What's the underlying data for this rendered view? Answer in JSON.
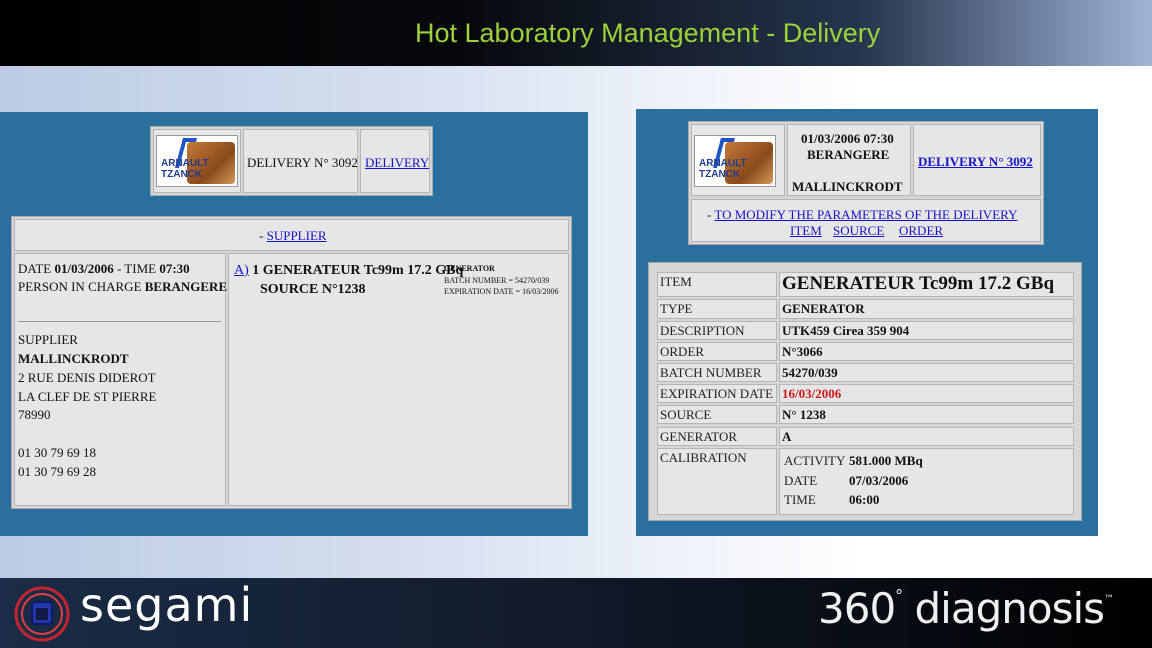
{
  "header": {
    "title": "Hot Laboratory Management - Delivery"
  },
  "footer": {
    "brand_left": "segami",
    "brand_right_number": "360",
    "brand_right_degree": "°",
    "brand_right_word": " diagnosis",
    "brand_right_tm": "™"
  },
  "logo": {
    "line1": "ARNAULT",
    "line2": "TZANCK"
  },
  "left": {
    "top_box": {
      "delivery_no": "DELIVERY N° 3092",
      "delivery_link": "DELIVERY"
    },
    "supplier_bar": {
      "prefix": "- ",
      "link": "SUPPLIER"
    },
    "info": {
      "date_prefix": "DATE ",
      "date": "01/03/2006",
      "time_prefix": " - TIME ",
      "time": "07:30",
      "person_prefix": "PERSON IN CHARGE ",
      "person": "BERANGERE",
      "supplier_label": "SUPPLIER",
      "supplier_name": "MALLINCKRODT",
      "address1": "2 RUE DENIS DIDEROT",
      "address2": "LA CLEF DE ST PIERRE",
      "zip": "78990",
      "phone1": "01 30 79 69 18",
      "phone2": "01 30 79 69 28"
    },
    "item": {
      "link": "A)",
      "line1": " 1 GENERATEUR Tc99m 17.2 GBq",
      "line2": "SOURCE N°1238",
      "tag": "GENERATOR",
      "batch": "BATCH NUMBER = 54270/039",
      "expiry": "EXPIRATION DATE = 16/03/2006"
    }
  },
  "right": {
    "top_box": {
      "datetime": "01/03/2006 07:30",
      "person": "BERANGERE",
      "supplier": "MALLINCKRODT",
      "delivery_link": "DELIVERY N° 3092"
    },
    "modify_bar": {
      "prefix": "- ",
      "link": "TO MODIFY THE PARAMETERS OF THE DELIVERY",
      "tab_item": "ITEM",
      "tab_source": "SOURCE",
      "tab_order": "ORDER"
    },
    "details": [
      {
        "label": "ITEM",
        "value": "GENERATEUR Tc99m 17.2 GBq"
      },
      {
        "label": "TYPE",
        "value": "GENERATOR"
      },
      {
        "label": "DESCRIPTION",
        "value": "UTK459 Cirea 359 904"
      },
      {
        "label": "ORDER",
        "value": "N°3066"
      },
      {
        "label": "BATCH NUMBER",
        "value": "54270/039"
      },
      {
        "label": "EXPIRATION DATE",
        "value": "16/03/2006"
      },
      {
        "label": "SOURCE",
        "value": "N° 1238"
      },
      {
        "label": "GENERATOR",
        "value": "A"
      },
      {
        "label": "CALIBRATION",
        "value": ""
      }
    ],
    "calibration": {
      "activity_label": "ACTIVITY",
      "activity": "581.000 MBq",
      "date_label": "DATE",
      "date": "07/03/2006",
      "time_label": "TIME",
      "time": "06:00"
    }
  },
  "colors": {
    "title_green": "#9dd13a",
    "panel_blue": "#2b6f9e",
    "link_blue": "#1414c8",
    "expiry_red": "#d01818"
  }
}
